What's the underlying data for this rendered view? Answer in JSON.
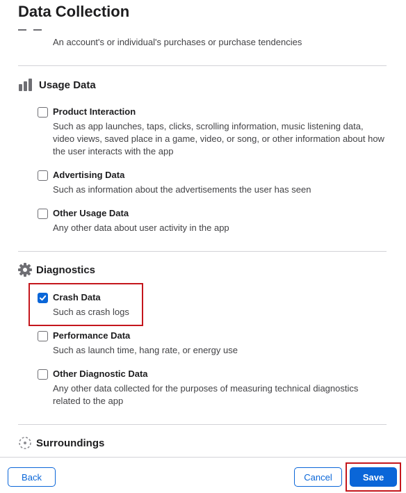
{
  "page": {
    "title": "Data Collection"
  },
  "previous_item": {
    "description": "An account's or individual's purchases or purchase tendencies"
  },
  "sections": {
    "usage": {
      "title": "Usage Data",
      "icon": "bar-chart-icon",
      "items": [
        {
          "label": "Product Interaction",
          "description": "Such as app launches, taps, clicks, scrolling information, music listening data, video views, saved place in a game, video, or song, or other information about how the user interacts with the app",
          "checked": false
        },
        {
          "label": "Advertising Data",
          "description": "Such as information about the advertisements the user has seen",
          "checked": false
        },
        {
          "label": "Other Usage Data",
          "description": "Any other data about user activity in the app",
          "checked": false
        }
      ]
    },
    "diagnostics": {
      "title": "Diagnostics",
      "icon": "gear-icon",
      "items": [
        {
          "label": "Crash Data",
          "description": "Such as crash logs",
          "checked": true
        },
        {
          "label": "Performance Data",
          "description": "Such as launch time, hang rate, or energy use",
          "checked": false
        },
        {
          "label": "Other Diagnostic Data",
          "description": "Any other data collected for the purposes of measuring technical diagnostics related to the app",
          "checked": false
        }
      ]
    },
    "surroundings": {
      "title": "Surroundings",
      "icon": "surroundings-icon"
    }
  },
  "footer": {
    "back_label": "Back",
    "cancel_label": "Cancel",
    "save_label": "Save"
  },
  "colors": {
    "accent": "#0a66d8",
    "highlight": "#c4161c",
    "divider": "#d2d2d7"
  }
}
